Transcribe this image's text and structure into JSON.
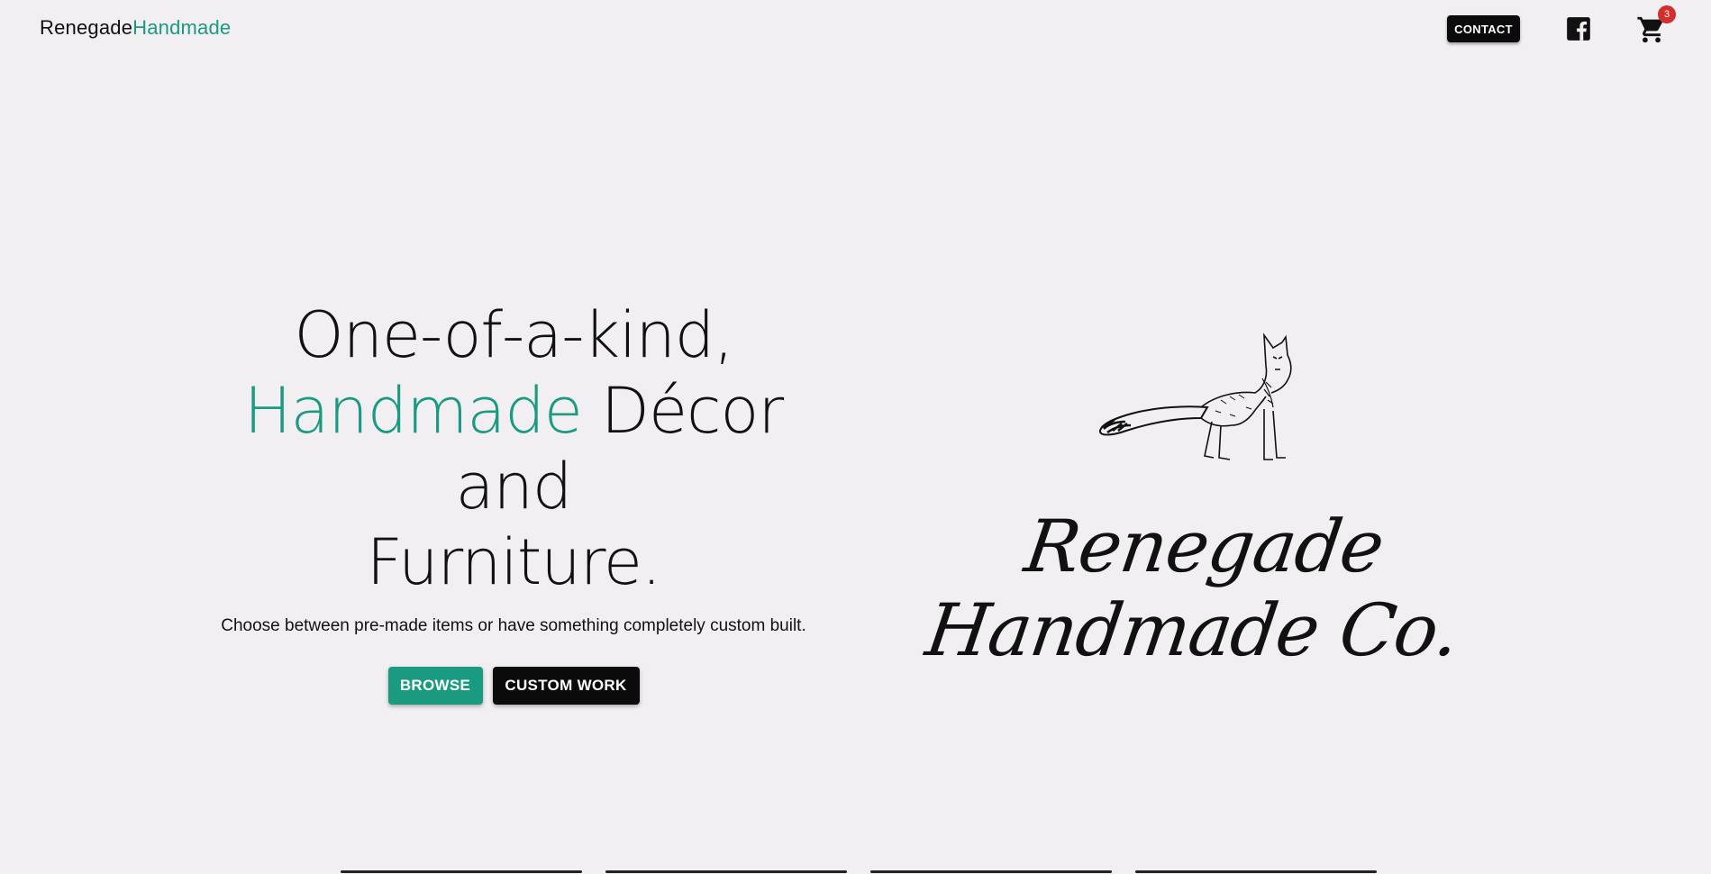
{
  "header": {
    "logo_part1": "Renegade",
    "logo_part2": "Handmade",
    "contact_label": "CONTACT",
    "facebook_icon": "facebook-icon",
    "cart_icon": "cart-icon",
    "cart_count": "3"
  },
  "hero": {
    "headline_line1": "One-of-a-kind,",
    "headline_accent": "Handmade",
    "headline_rest": " Décor and",
    "headline_line3": "Furniture.",
    "subtitle": "Choose between pre-made items or have something completely custom built.",
    "browse_label": "BROWSE",
    "custom_label": "CUSTOM WORK",
    "brand_script": "Renegade Handmade Co.",
    "illustration": "fox-illustration"
  },
  "colors": {
    "background": "#f1eff2",
    "accent": "#1a9a80",
    "dark": "#0b0b0b",
    "badge": "#d32f2f"
  }
}
